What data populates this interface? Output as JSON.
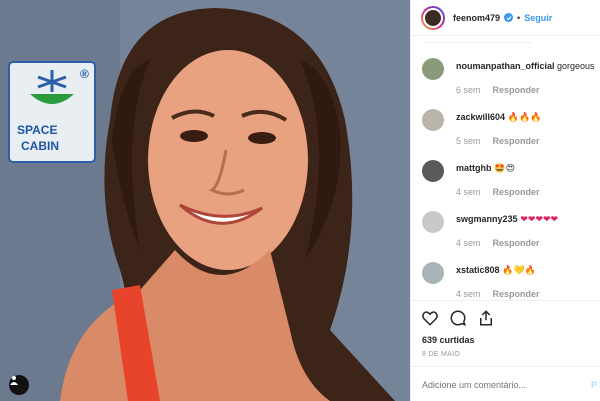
{
  "header": {
    "username": "feenom479",
    "separator": "•",
    "follow_label": "Seguir"
  },
  "photo": {
    "sign_line1": "SPACE",
    "sign_line2": "CABIN",
    "registered_mark": "®"
  },
  "comments": [
    {
      "user": "noumanpathan_official",
      "text": " gorgeous",
      "time": "6 sem",
      "reply": "Responder"
    },
    {
      "user": "zackwill604",
      "text": " 🔥🔥🔥",
      "time": "5 sem",
      "reply": "Responder"
    },
    {
      "user": "mattghb",
      "text": " 🤩😍",
      "time": "4 sem",
      "reply": "Responder"
    },
    {
      "user": "swgmanny235",
      "text": " ❤❤❤❤❤",
      "time": "4 sem",
      "reply": "Responder"
    },
    {
      "user": "xstatic808",
      "text": " 🔥💛🔥",
      "time": "4 sem",
      "reply": "Responder"
    }
  ],
  "footer": {
    "likes": "639 curtidas",
    "date": "8 DE MAIO",
    "comment_placeholder": "Adicione um comentário...",
    "post_label": "P"
  },
  "icons": [
    "heart-icon",
    "comment-icon",
    "share-icon",
    "tag-user-icon",
    "verified-icon"
  ],
  "colors": {
    "accent": "#3897f0",
    "text": "#262626",
    "muted": "#999999",
    "swimsuit": "#e8442c"
  }
}
